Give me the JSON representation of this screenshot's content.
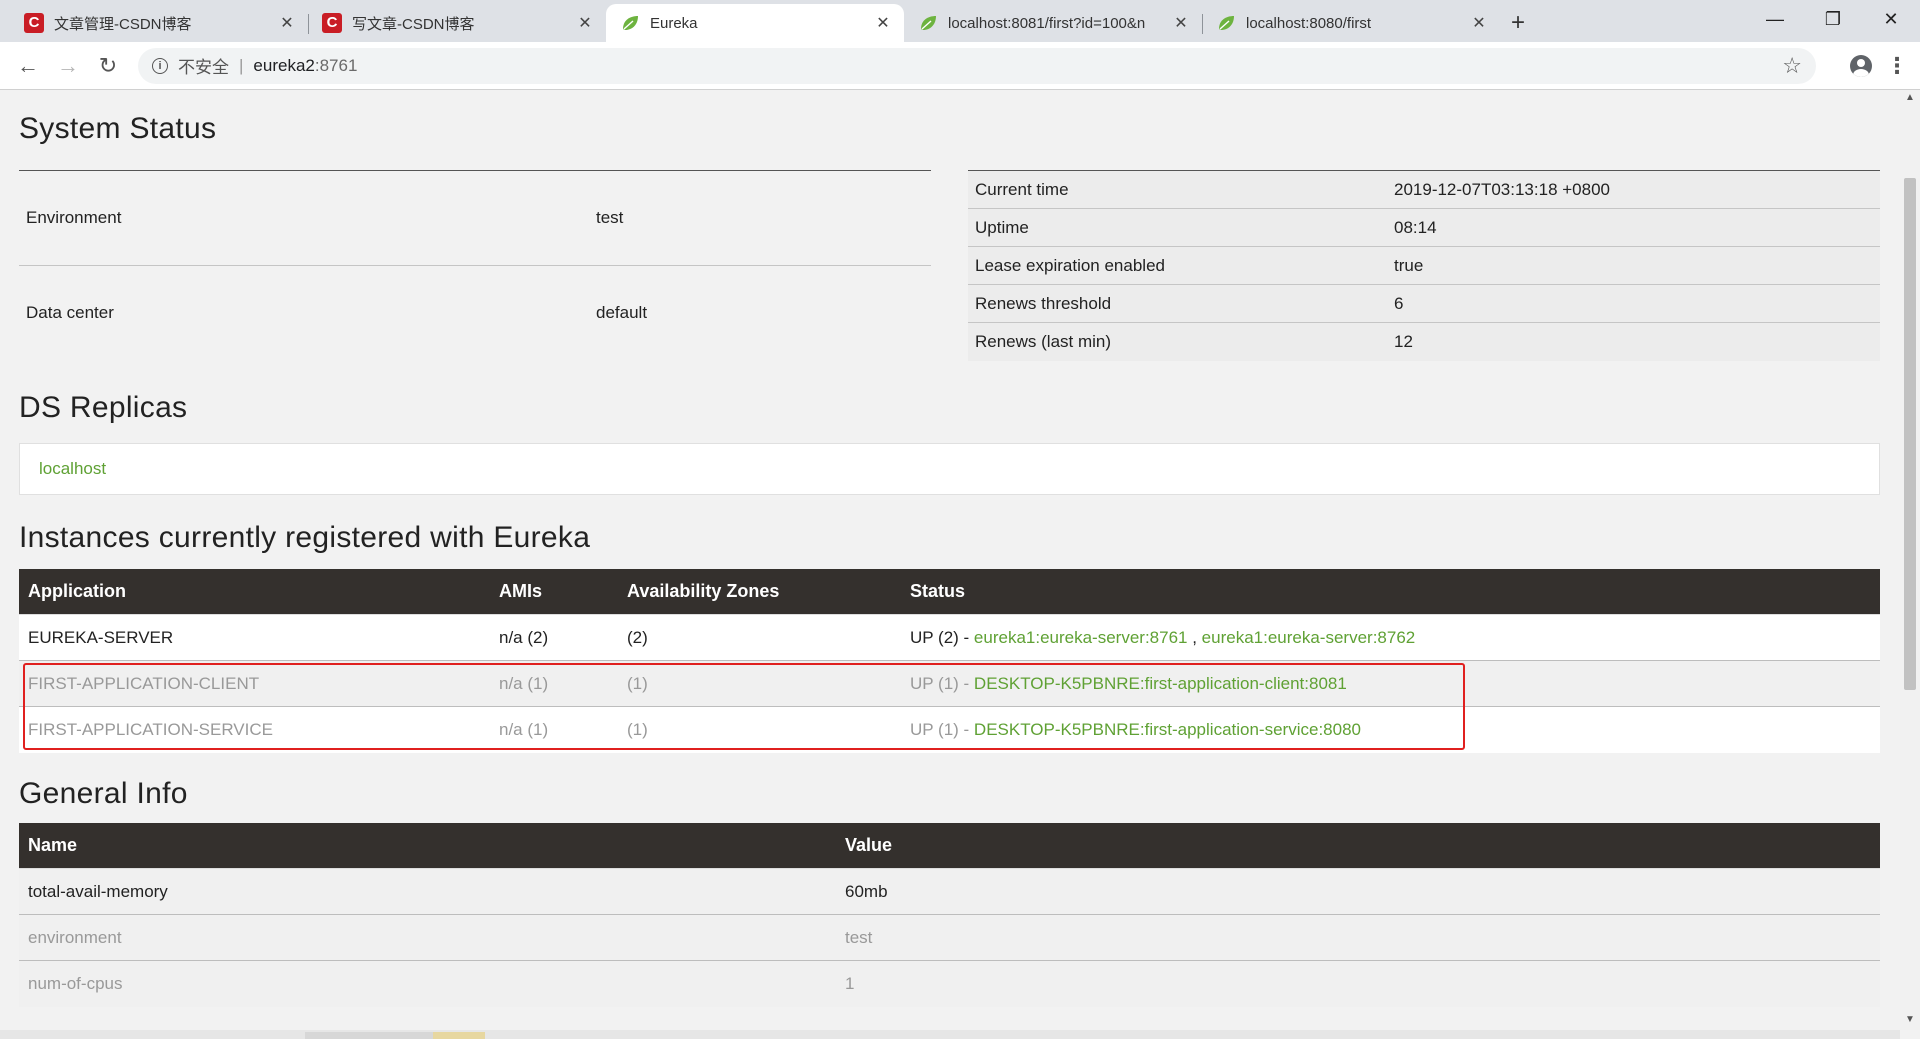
{
  "browser": {
    "tabs": [
      {
        "title": "文章管理-CSDN博客",
        "favicon": "csdn-icon",
        "active": false
      },
      {
        "title": "写文章-CSDN博客",
        "favicon": "csdn-icon",
        "active": false
      },
      {
        "title": "Eureka",
        "favicon": "spring-leaf-icon",
        "active": true
      },
      {
        "title": "localhost:8081/first?id=100&n",
        "favicon": "spring-leaf-icon",
        "active": false
      },
      {
        "title": "localhost:8080/first",
        "favicon": "spring-leaf-icon",
        "active": false
      }
    ],
    "csdn_letter": "C",
    "security_label": "不安全",
    "url_host": "eureka2",
    "url_port": ":8761"
  },
  "system_status": {
    "title": "System Status",
    "left": [
      {
        "key": "Environment",
        "value": "test"
      },
      {
        "key": "Data center",
        "value": "default"
      }
    ],
    "right": [
      {
        "key": "Current time",
        "value": "2019-12-07T03:13:18 +0800"
      },
      {
        "key": "Uptime",
        "value": "08:14"
      },
      {
        "key": "Lease expiration enabled",
        "value": "true"
      },
      {
        "key": "Renews threshold",
        "value": "6"
      },
      {
        "key": "Renews (last min)",
        "value": "12"
      }
    ]
  },
  "ds_replicas": {
    "title": "DS Replicas",
    "items": [
      "localhost"
    ]
  },
  "instances": {
    "title": "Instances currently registered with Eureka",
    "headers": [
      "Application",
      "AMIs",
      "Availability Zones",
      "Status"
    ],
    "rows": [
      {
        "application": "EUREKA-SERVER",
        "amis": "n/a (2)",
        "zones": "(2)",
        "status_prefix": "UP (2) - ",
        "links": [
          "eureka1:eureka-server:8761",
          "eureka1:eureka-server:8762"
        ]
      },
      {
        "application": "FIRST-APPLICATION-CLIENT",
        "amis": "n/a (1)",
        "zones": "(1)",
        "status_prefix": "UP (1) - ",
        "links": [
          "DESKTOP-K5PBNRE:first-application-client:8081"
        ]
      },
      {
        "application": "FIRST-APPLICATION-SERVICE",
        "amis": "n/a (1)",
        "zones": "(1)",
        "status_prefix": "UP (1) - ",
        "links": [
          "DESKTOP-K5PBNRE:first-application-service:8080"
        ]
      }
    ],
    "link_separator": " , "
  },
  "general_info": {
    "title": "General Info",
    "headers": [
      "Name",
      "Value"
    ],
    "rows": [
      {
        "name": "total-avail-memory",
        "value": "60mb"
      },
      {
        "name": "environment",
        "value": "test"
      },
      {
        "name": "num-of-cpus",
        "value": "1"
      }
    ]
  },
  "colors": {
    "link_green": "#5fa134",
    "header_dark": "#34302d",
    "highlight_red": "#e0201f"
  }
}
